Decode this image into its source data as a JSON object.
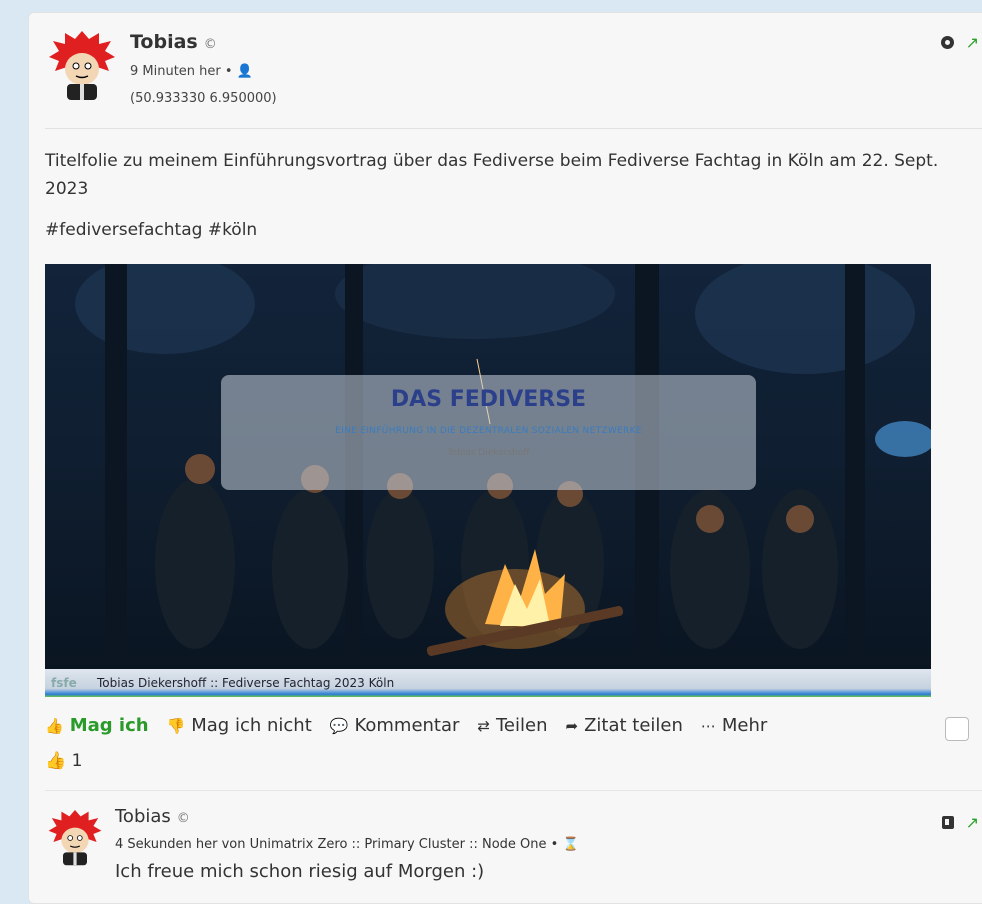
{
  "post": {
    "author": "Tobias",
    "privacy_icon": "creative-commons-icon",
    "time": "9 Minuten her",
    "visibility_icon": "user-icon",
    "coordinates": "(50.933330 6.950000)",
    "text": "Titelfolie zu meinem Einführungsvortrag über das Fediverse beim Fediverse Fachtag in Köln am 22. Sept. 2023",
    "tags": "#fediversefachtag #köln",
    "image": {
      "title": "DAS FEDIVERSE",
      "subtitle": "EINE EINFÜHRUNG IN DIE DEZENTRALEN SOZIALEN NETZWERKE",
      "author": "Tobias Diekershoff",
      "footer_logo": "fsfe",
      "footer_text": "Tobias Diekershoff :: Fediverse Fachtag 2023 Köln"
    },
    "actions": {
      "like": "Mag ich",
      "dislike": "Mag ich nicht",
      "comment": "Kommentar",
      "share": "Teilen",
      "quote": "Zitat teilen",
      "more": "Mehr"
    },
    "likes_count": "1"
  },
  "comment": {
    "author": "Tobias",
    "meta": "4 Sekunden her von Unimatrix Zero :: Primary Cluster :: Node One",
    "text": "Ich freue mich schon riesig auf Morgen :)"
  },
  "colors": {
    "like_green": "#2a9a2a",
    "background": "#d9e8f3",
    "card": "#f7f7f7"
  }
}
